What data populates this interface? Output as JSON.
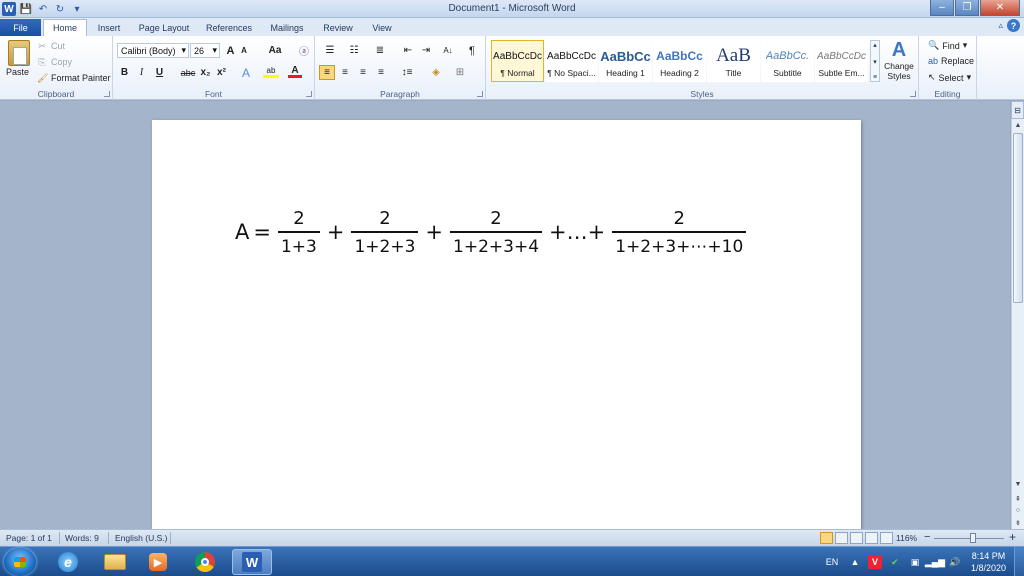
{
  "window": {
    "title": "Document1 - Microsoft Word",
    "controls": {
      "minimize": "–",
      "maximize": "❐",
      "close": "✕"
    }
  },
  "qat": {
    "word_logo": "W",
    "save": "💾",
    "undo": "↶",
    "redo": "↻",
    "customize": "▾"
  },
  "tabs": [
    "File",
    "Home",
    "Insert",
    "Page Layout",
    "References",
    "Mailings",
    "Review",
    "View"
  ],
  "active_tab": "Home",
  "ribbon": {
    "clipboard": {
      "label": "Clipboard",
      "paste": "Paste",
      "cut": "Cut",
      "copy": "Copy",
      "format_painter": "Format Painter"
    },
    "font": {
      "label": "Font",
      "font_name": "Calibri (Body)",
      "font_size": "26",
      "bold": "B",
      "italic": "I",
      "underline": "U",
      "strikethrough": "abc",
      "subscript": "x₂",
      "superscript": "x²",
      "grow": "A",
      "shrink": "A",
      "change_case": "Aa"
    },
    "paragraph": {
      "label": "Paragraph",
      "pilcrow": "¶",
      "sort": "A↓"
    },
    "styles": {
      "label": "Styles",
      "items": [
        {
          "preview": "AaBbCcDc",
          "name": "¶ Normal"
        },
        {
          "preview": "AaBbCcDc",
          "name": "¶ No Spaci..."
        },
        {
          "preview": "AaBbCc",
          "name": "Heading 1"
        },
        {
          "preview": "AaBbCc",
          "name": "Heading 2"
        },
        {
          "preview": "AaB",
          "name": "Title"
        },
        {
          "preview": "AaBbCc.",
          "name": "Subtitle"
        },
        {
          "preview": "AaBbCcDc",
          "name": "Subtle Em..."
        }
      ],
      "change_styles_line1": "Change",
      "change_styles_line2": "Styles"
    },
    "editing": {
      "label": "Editing",
      "find": "Find",
      "replace": "Replace",
      "select": "Select"
    }
  },
  "document": {
    "equation": {
      "lhs": "A",
      "eq": "=",
      "terms": [
        {
          "num": "2",
          "den": "1+3"
        },
        {
          "num": "2",
          "den": "1+2+3"
        },
        {
          "num": "2",
          "den": "1+2+3+4"
        },
        {
          "num": "2",
          "den": "1+2+3+⋯+10"
        }
      ],
      "plus": "+",
      "ellipsis": "+…+"
    }
  },
  "status": {
    "page": "Page: 1 of 1",
    "words": "Words: 9",
    "language": "English (U.S.)",
    "zoom": "116%",
    "zoom_out": "−",
    "zoom_in": "+"
  },
  "tray": {
    "lang": "EN",
    "time": "8:14 PM",
    "date": "1/8/2020"
  },
  "colors": {
    "accent": "#2b5fb4",
    "style_selected": "#e2b42d",
    "taskbar": "#1b4c8c"
  }
}
